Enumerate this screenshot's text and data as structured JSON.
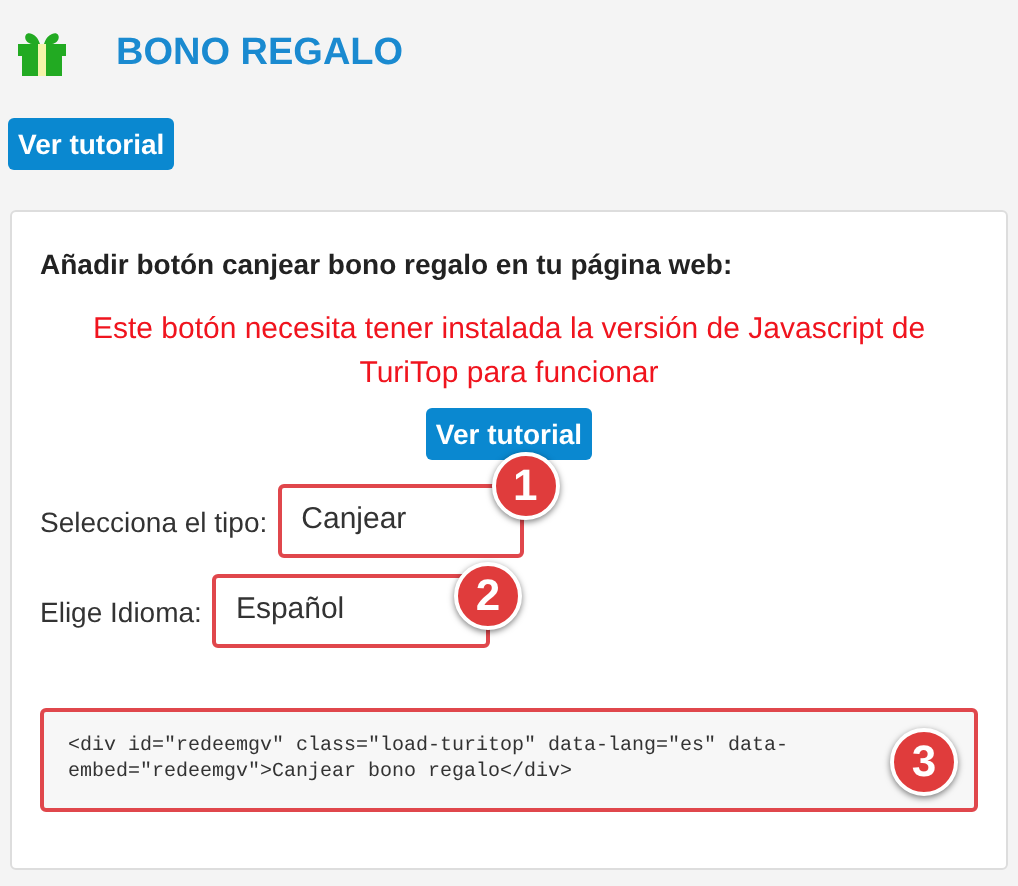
{
  "header": {
    "title": "BONO REGALO"
  },
  "tutorial_button": "Ver tutorial",
  "card": {
    "heading": "Añadir botón canjear bono regalo en tu página web:",
    "warning": "Este botón necesita tener instalada la versión de Javascript de TuriTop para funcionar",
    "tutorial_button": "Ver tutorial",
    "fields": [
      {
        "label": "Selecciona el tipo:",
        "value": "Canjear",
        "marker": "1"
      },
      {
        "label": "Elige Idioma:",
        "value": "Español",
        "marker": "2"
      }
    ],
    "code": {
      "text": "<div id=\"redeemgv\" class=\"load-turitop\" data-lang=\"es\" data-embed=\"redeemgv\">Canjear bono regalo</div>",
      "marker": "3"
    }
  }
}
